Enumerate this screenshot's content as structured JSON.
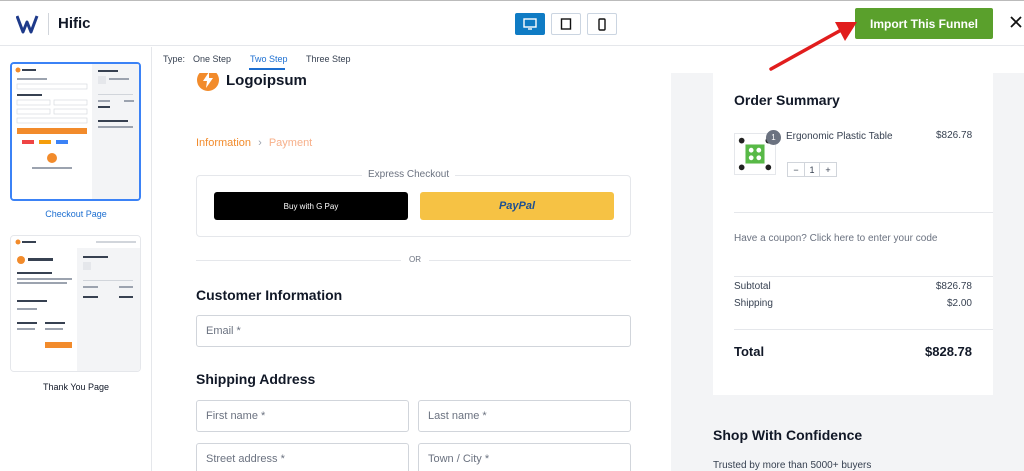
{
  "header": {
    "brand": "Hific",
    "import_label": "Import This Funnel",
    "devices": [
      "desktop-icon",
      "tablet-icon",
      "mobile-icon"
    ],
    "accent": "#5aa02c"
  },
  "sidebar": {
    "items": [
      {
        "label": "Checkout Page",
        "selected": true
      },
      {
        "label": "Thank You Page",
        "selected": false
      }
    ]
  },
  "typebar": {
    "label": "Type:",
    "tabs": [
      {
        "label": "One Step"
      },
      {
        "label": "Two Step",
        "active": true
      },
      {
        "label": "Three Step"
      }
    ]
  },
  "checkout": {
    "logo_text": "Logoipsum",
    "breadcrumb": {
      "information": "Information",
      "separator": "›",
      "payment": "Payment"
    },
    "express_title": "Express Checkout",
    "gpay_label": "Buy with G Pay",
    "paypal_label": "PayPal",
    "or_label": "OR",
    "customer_title": "Customer Information",
    "email_placeholder": "Email *",
    "shipping_title": "Shipping Address",
    "first_name_placeholder": "First name *",
    "last_name_placeholder": "Last name *",
    "street_placeholder": "Street address *",
    "town_placeholder": "Town / City *"
  },
  "summary": {
    "title": "Order Summary",
    "product": {
      "name": "Ergonomic Plastic Table",
      "price": "$826.78",
      "qty": "1",
      "badge": "1",
      "minus": "−",
      "plus": "+"
    },
    "coupon": "Have a coupon? Click here to enter your code",
    "subtotal_label": "Subtotal",
    "subtotal_value": "$826.78",
    "shipping_label": "Shipping",
    "shipping_value": "$2.00",
    "total_label": "Total",
    "total_value": "$828.78"
  },
  "confidence": {
    "title": "Shop With Confidence",
    "text": "Trusted by more than 5000+ buyers"
  }
}
